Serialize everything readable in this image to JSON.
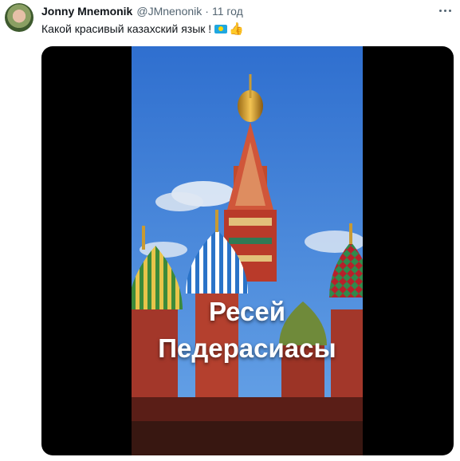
{
  "tweet": {
    "author_name": "Jonny Mnemonik",
    "author_handle": "@JMnenonik",
    "separator": "·",
    "timestamp": "11 год",
    "text": "Какой красивый казахский язык !",
    "emoji_icons": [
      "kazakhstan-flag-icon",
      "thumbs-up-icon"
    ],
    "more_icon": "more-options-icon"
  },
  "media": {
    "caption_line1": "Ресей",
    "caption_line2": "Педерасиасы"
  },
  "colors": {
    "name": "#0f1419",
    "secondary": "#536471",
    "media_bg": "#000000",
    "sky": "#3a7ed4",
    "caption": "#ffffff"
  }
}
